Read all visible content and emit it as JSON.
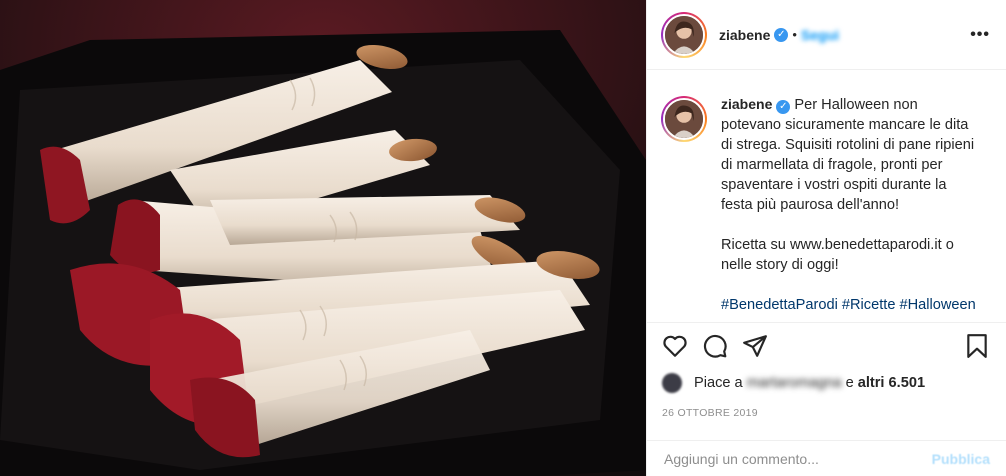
{
  "post": {
    "username": "ziabene",
    "follow_label": "Segui",
    "dot": "•",
    "more_icon": "more-options-icon",
    "caption_lines": [
      "Per Halloween non",
      "potevano sicuramente mancare le dita",
      "di strega. Squisiti rotolini di pane ripieni",
      "di marmellata di fragole, pronti per",
      "spaventare i vostri ospiti durante la",
      "festa più paurosa dell'anno!"
    ],
    "recipe_line1": "Ricetta su www.benedettaparodi.it o",
    "recipe_line2": "nelle story di oggi!",
    "hashtags": "#BenedettaParodi #Ricette #Halloween",
    "likes_prefix": "Piace a",
    "likes_user": "martaromagna",
    "likes_connector": "e",
    "likes_count": "altri 6.501",
    "date": "26 OTTOBRE 2019",
    "comment_placeholder": "Aggiungi un commento...",
    "publish_label": "Pubblica"
  },
  "colors": {
    "accent_blue": "#0095f6",
    "verified_blue": "#3897f0",
    "hashtag": "#00376b",
    "muted": "#8e8e8e",
    "publish_disabled": "#b2dffc"
  },
  "icons": [
    "heart-icon",
    "comment-icon",
    "share-icon",
    "bookmark-icon",
    "verified-icon"
  ]
}
